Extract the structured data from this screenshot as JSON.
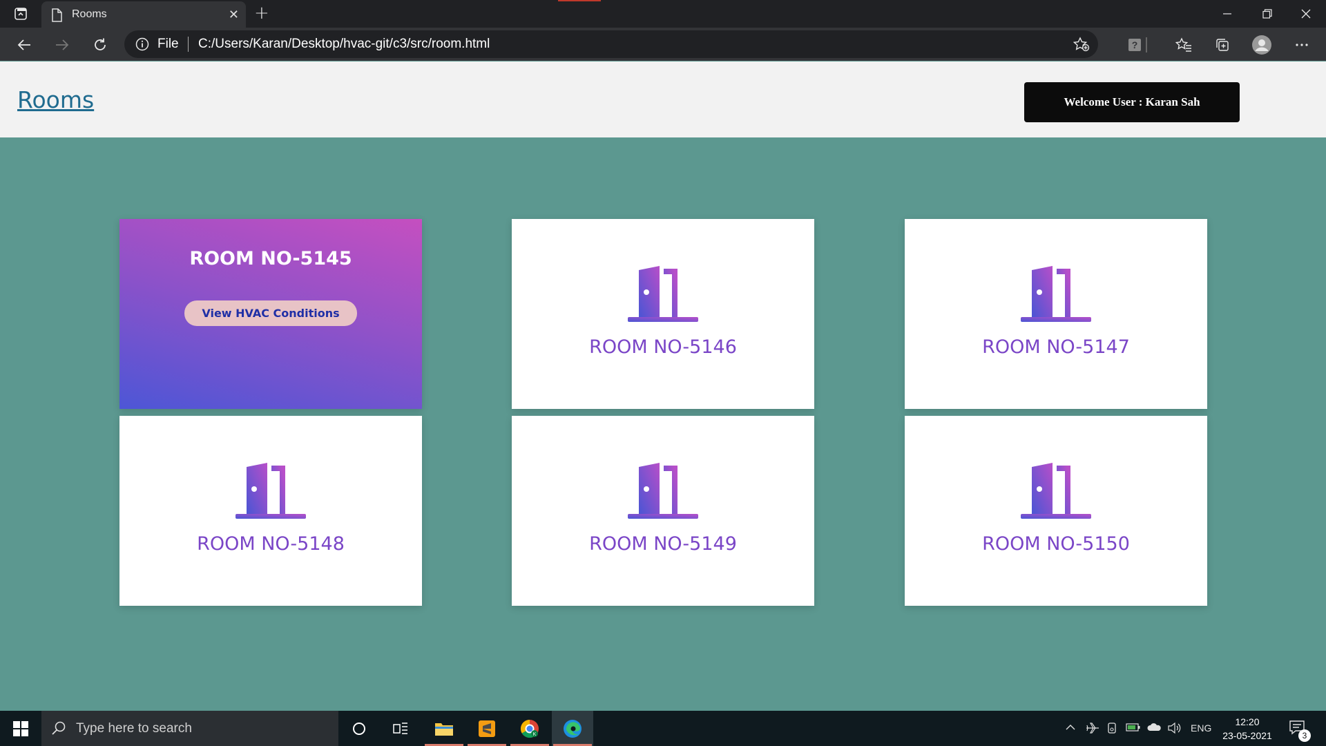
{
  "browser": {
    "tab": {
      "title": "Rooms"
    },
    "address": {
      "scheme": "File",
      "url": "C:/Users/Karan/Desktop/hvac-git/c3/src/room.html"
    }
  },
  "page": {
    "title": "Rooms",
    "welcome": "Welcome User : Karan Sah",
    "hvac_button": "View HVAC Conditions",
    "rooms": [
      {
        "label": "ROOM NO-5145",
        "active": true
      },
      {
        "label": "ROOM NO-5146",
        "active": false
      },
      {
        "label": "ROOM NO-5147",
        "active": false
      },
      {
        "label": "ROOM NO-5148",
        "active": false
      },
      {
        "label": "ROOM NO-5149",
        "active": false
      },
      {
        "label": "ROOM NO-5150",
        "active": false
      }
    ]
  },
  "taskbar": {
    "search_placeholder": "Type here to search",
    "language": "ENG",
    "time": "12:20",
    "date": "23-05-2021",
    "notification_count": "3"
  },
  "colors": {
    "page_background": "#5c9890",
    "room_label": "#7a45c7",
    "header_link": "#1f6b8f"
  }
}
